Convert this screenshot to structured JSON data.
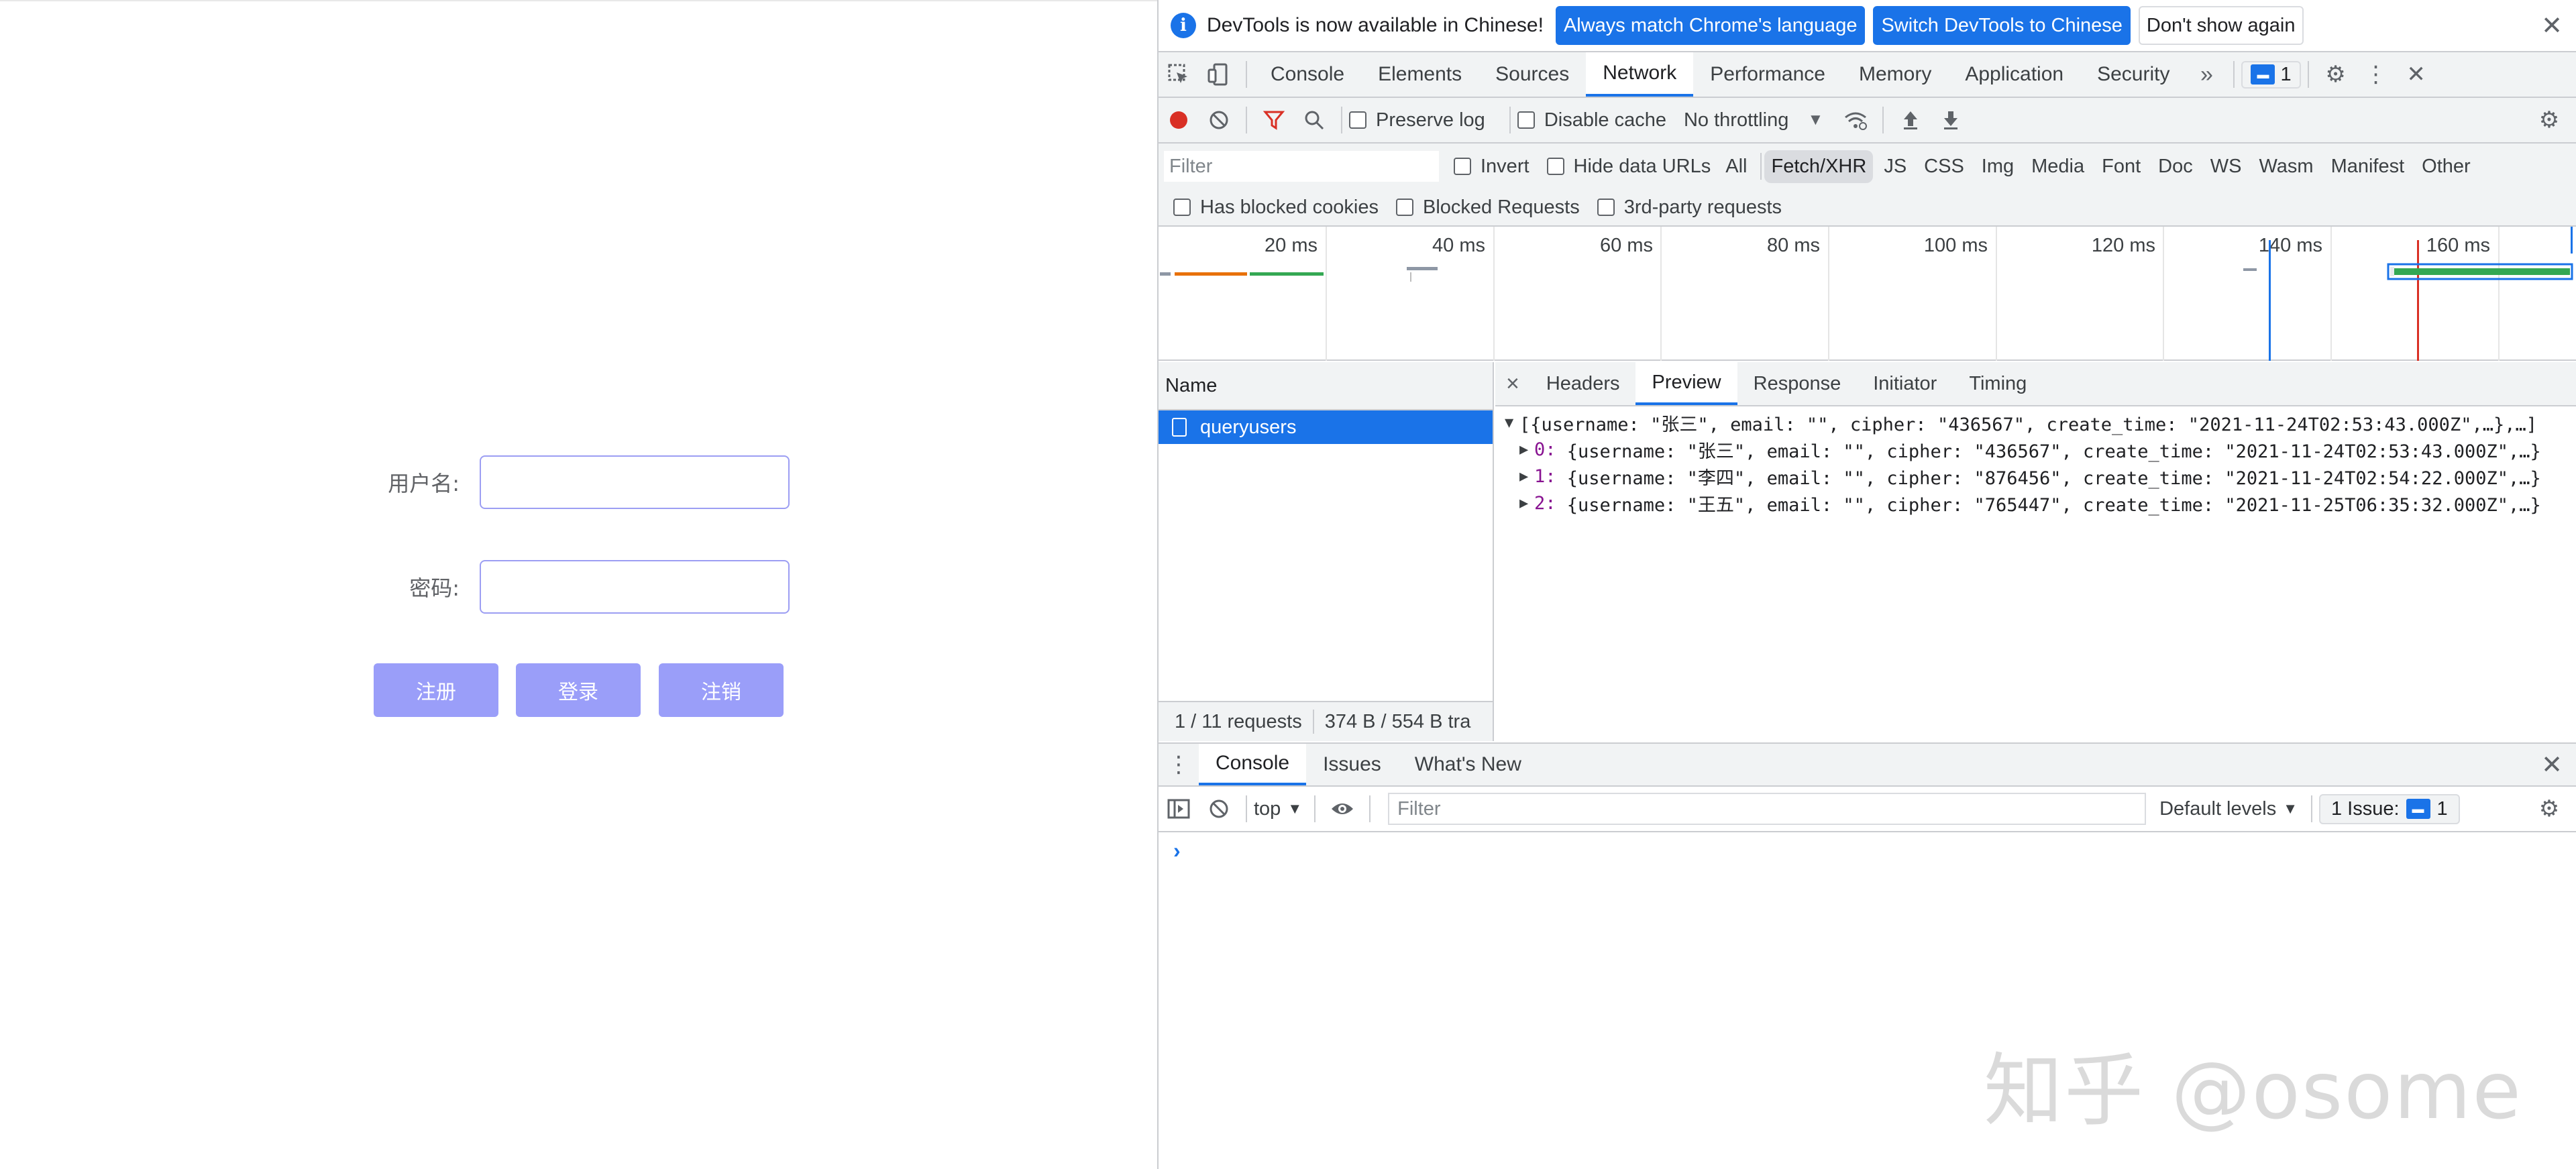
{
  "app": {
    "username_label": "用户名:",
    "password_label": "密码:",
    "register_button": "注册",
    "login_button": "登录",
    "logout_button": "注销"
  },
  "infobar": {
    "message": "DevTools is now available in Chinese!",
    "match_language": "Always match Chrome's language",
    "switch_chinese": "Switch DevTools to Chinese",
    "dont_show": "Don't show again"
  },
  "main_tabs": [
    "Console",
    "Elements",
    "Sources",
    "Network",
    "Performance",
    "Memory",
    "Application",
    "Security"
  ],
  "issues_count": "1",
  "network_toolbar": {
    "preserve_log": "Preserve log",
    "disable_cache": "Disable cache",
    "throttling": "No throttling"
  },
  "filter_bar": {
    "placeholder": "Filter",
    "invert": "Invert",
    "hide_data_urls": "Hide data URLs",
    "types": [
      "All",
      "Fetch/XHR",
      "JS",
      "CSS",
      "Img",
      "Media",
      "Font",
      "Doc",
      "WS",
      "Wasm",
      "Manifest",
      "Other"
    ],
    "has_blocked_cookies": "Has blocked cookies",
    "blocked_requests": "Blocked Requests",
    "third_party": "3rd-party requests"
  },
  "overview": {
    "ticks": [
      "20 ms",
      "40 ms",
      "60 ms",
      "80 ms",
      "100 ms",
      "120 ms",
      "140 ms",
      "160 ms"
    ]
  },
  "requests": {
    "header": "Name",
    "items": [
      "queryusers"
    ],
    "status_count": "1 / 11 requests",
    "status_size": "374 B / 554 B tra"
  },
  "detail": {
    "close": "×",
    "tabs": [
      "Headers",
      "Preview",
      "Response",
      "Initiator",
      "Timing"
    ],
    "summary": "[{username: \"张三\", email: \"\", cipher: \"436567\", create_time: \"2021-11-24T02:53:43.000Z\",…},…]",
    "rows": [
      {
        "index": "0:",
        "text": "{username: \"张三\", email: \"\", cipher: \"436567\", create_time: \"2021-11-24T02:53:43.000Z\",…}"
      },
      {
        "index": "1:",
        "text": "{username: \"李四\", email: \"\", cipher: \"876456\", create_time: \"2021-11-24T02:54:22.000Z\",…}"
      },
      {
        "index": "2:",
        "text": "{username: \"王五\", email: \"\", cipher: \"765447\", create_time: \"2021-11-25T06:35:32.000Z\",…}"
      }
    ]
  },
  "drawer": {
    "tabs": [
      "Console",
      "Issues",
      "What's New"
    ],
    "context": "top",
    "filter_placeholder": "Filter",
    "levels": "Default levels",
    "issue_label": "1 Issue:",
    "issue_count": "1",
    "prompt": "›"
  },
  "watermark": "知乎 @osome",
  "colors": {
    "accent": "#1a73e8",
    "app_button": "#9a9ef9",
    "input_border": "#9c9ef3",
    "record": "#d93025"
  }
}
